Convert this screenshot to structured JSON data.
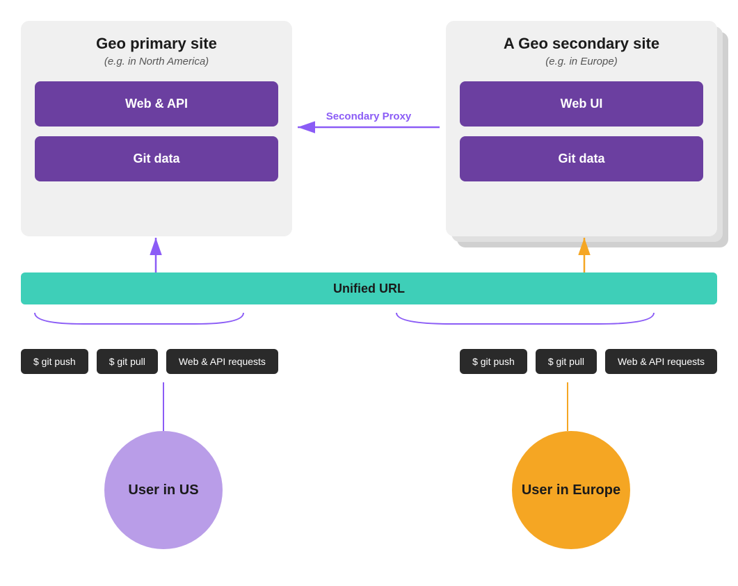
{
  "primary_site": {
    "title": "Geo primary site",
    "subtitle": "(e.g. in North America)",
    "box1": "Web & API",
    "box2": "Git data"
  },
  "secondary_site": {
    "title": "A Geo secondary site",
    "subtitle": "(e.g. in Europe)",
    "box1": "Web UI",
    "box2": "Git data"
  },
  "proxy_label": "Secondary Proxy",
  "unified_url": "Unified URL",
  "actions_left": {
    "btn1": "$ git push",
    "btn2": "$ git pull",
    "btn3": "Web & API requests"
  },
  "actions_right": {
    "btn1": "$ git push",
    "btn2": "$ git pull",
    "btn3": "Web & API requests"
  },
  "user_us": "User in US",
  "user_europe": "User in Europe",
  "colors": {
    "purple": "#6b3fa0",
    "teal": "#3ecfb8",
    "proxy_arrow": "#8b5cf6",
    "orange_arrow": "#f5a623",
    "purple_arrow": "#8b5cf6"
  }
}
